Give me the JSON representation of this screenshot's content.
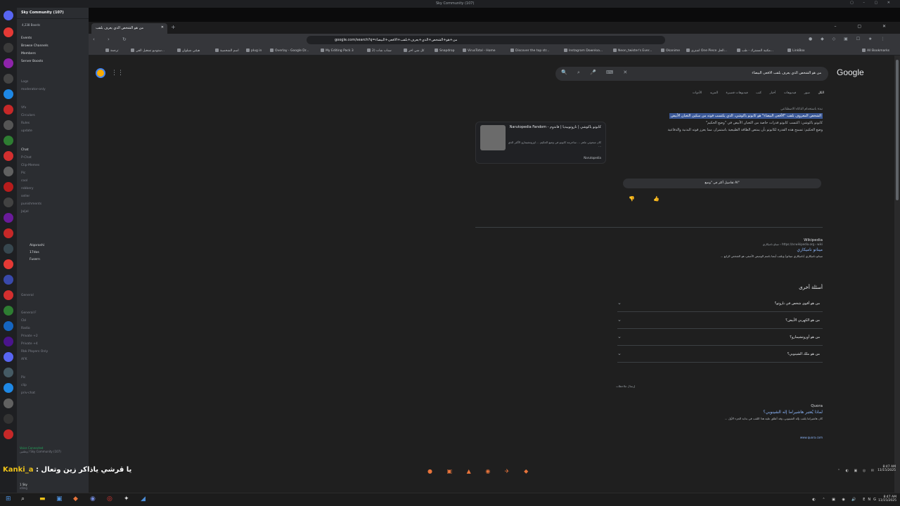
{
  "discord": {
    "window_title": "Sky Community (107)",
    "server_name": "Sky Community (107)",
    "boosts": "4,238 Boosts",
    "channels": [
      "Events",
      "Browse Channels",
      "Members",
      "Server Boosts",
      "Logs",
      "moderator-only",
      "Vfx",
      "Circulars",
      "Rules",
      "update",
      "Chat",
      "P-Chat",
      "Clip-Memes",
      "Pic",
      "cool",
      "robbery",
      "seller",
      "punishments",
      "Jaljel"
    ],
    "voice_users": [
      "Alqorashi",
      "17dos",
      "Fusern"
    ],
    "voice_channels": [
      "General",
      "General F",
      "Cbl",
      "Radio",
      "Private +2",
      "Private +4",
      "Rbk Players Only",
      "AFK",
      "Pic",
      "clip",
      "priv-chat"
    ],
    "voice_status": "Voice Connected",
    "voice_server": "وظفين / Sky Community (107)",
    "user_name": "1 Sky",
    "user_status": "idling"
  },
  "browser": {
    "tab_title": "من هو الشخص الذي يعرف بلقب",
    "url": "google.com/search?q=من+هو+الشخص+الذي+يعرف+بلقب+الافعى+البيضاء",
    "bookmarks": [
      "ترجمة",
      "ستوديو تشغيل الفي...",
      "هيئتي شيلوان",
      "اسم الشخصية",
      "plug in",
      "Overlay - Google Dr...",
      "My Editing Pack 3",
      "سناب شات (2",
      "كل شي اخر",
      "Snapdrop",
      "VirusTotal - Home",
      "Discover the top str...",
      "Instagram Downloa...",
      "Neon_twister's Ever...",
      "Okanime",
      "اشتري One Piece الحل...",
      "مكتبة المشترك - طب...",
      "LinkBox"
    ],
    "all_bookmarks": "All Bookmarks"
  },
  "google": {
    "logo": "Google",
    "query": "من هو الشخص الذي يعرف بلقب الافعى البيضاء",
    "tabs": [
      "الكل",
      "صور",
      "فيديوهات",
      "أخبار",
      "كتب",
      "فيديوهات قصيرة",
      "المزيد",
      "الأدوات"
    ],
    "ai_header": "نبذة باستخدام الذكاء الاصطناعي",
    "ai_highlight": "الشخص المعروف بلقب \"الأفعى البيضاء\" هو كابوتو ياكوشي، الذي يكتسب قوته من سكين الثعبان الأبيض",
    "ai_bullets": [
      "كابوتو ياكوشي: اكتسب كابوتو قدرات خاصة من الثعبان الأبيض في \"وضع الحكيم\"",
      "وضع الحكيم: تسمح هذه القدرة لكابوتو بأن يمتص الطاقة الطبيعية باستمرار، مما يعزز قوته البدنية والدفاعية"
    ],
    "card_title": "كابوتو ياكوشي | ناروتوبيديا | فاندوم - Narutopedia Fandom",
    "card_desc": "كان مبحوثي ماهر ... ساحرمه كابوتو في وضع الحكيم ... اوروتشيمارو الأكثر الذي ...",
    "card_source": "Narutopedia",
    "ai_more": "تفاصيل أكثر في \"وضع AI\"",
    "result1_source": "Wikipedia",
    "result1_url": "https://ar.wikipedia.org › wiki › ميتاو ناميكازي",
    "result1_link": "ميناتو ناميكازي",
    "result1_snippet": "ميناتو ناميكازي (ناميكازي ميناتو) ويلقب أيضا باسم الوميض الأصفر، هو الشخص الرابع ...",
    "paa_title": "أسئلة أخرى",
    "paa": [
      "من هو أقوى شخص في ناروتو؟",
      "من هو الكهربي الأبيض؟",
      "من هو أوروتشيمارو؟",
      "من هو ملك الشينوبي؟"
    ],
    "feedback": "إرسال ملاحظات",
    "result2_source": "Quora",
    "result2_link": "لماذا يُعتبر هاشيراما إله الشينوبي؟",
    "result2_snippet": "كان هاشيراما يلقب بإله الشينوبي، وقد أطلق عليه هذا اللقب في بداية الجزء الأول ...",
    "result2_url": "www.quora.com"
  },
  "overlay": {
    "chat_name": "Kanki_a",
    "chat_text": ": يا قرشي ياذاكر زين وتعال"
  },
  "system": {
    "time": "8:47 AM",
    "date": "11/15/2025",
    "lang": "ENG"
  }
}
